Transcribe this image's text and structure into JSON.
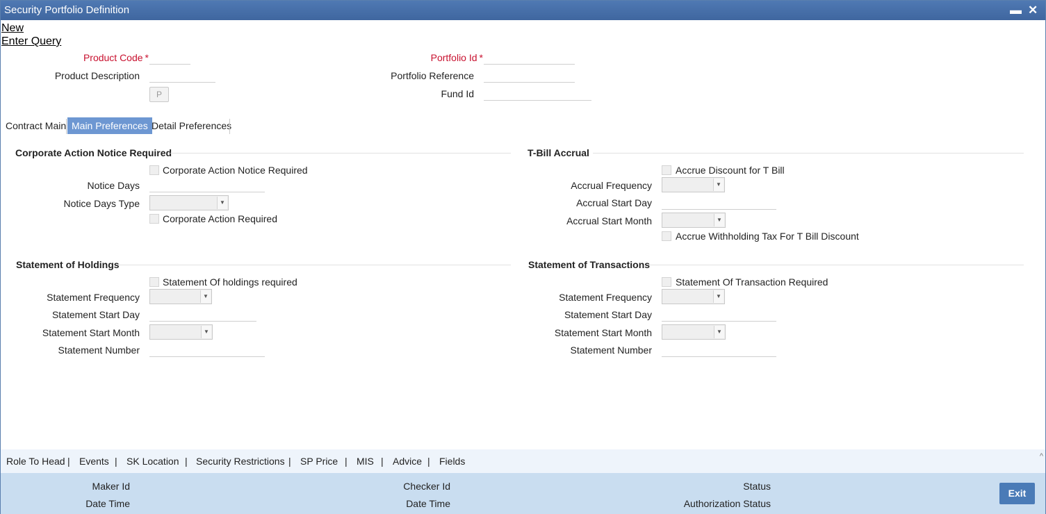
{
  "window": {
    "title": "Security Portfolio Definition",
    "minimize_icon": "minimize-icon",
    "close_icon": "close-icon",
    "minimize_glyph": "▬",
    "close_glyph": "✕"
  },
  "menu": {
    "new": "New",
    "enter_query": "Enter Query"
  },
  "header": {
    "product_code": "Product Code",
    "product_description": "Product Description",
    "p_button": "P",
    "portfolio_id": "Portfolio Id",
    "portfolio_reference": "Portfolio Reference",
    "fund_id": "Fund Id",
    "required_mark": "*"
  },
  "tabs": {
    "contract_main": "Contract Main",
    "main_preferences": "Main Preferences",
    "detail_preferences": "Detail Preferences",
    "active": "Main Preferences"
  },
  "corporate_action": {
    "title": "Corporate Action Notice Required",
    "notice_required": "Corporate Action Notice Required",
    "notice_days": "Notice Days",
    "notice_days_type": "Notice Days Type",
    "action_required": "Corporate Action Required"
  },
  "tbill": {
    "title": "T-Bill Accrual",
    "accrue_discount": "Accrue Discount for T Bill",
    "accrual_frequency": "Accrual Frequency",
    "accrual_start_day": "Accrual Start Day",
    "accrual_start_month": "Accrual Start Month",
    "accrue_withholding": "Accrue Withholding Tax For T Bill Discount"
  },
  "holdings": {
    "title": "Statement of Holdings",
    "required": "Statement Of holdings required",
    "frequency": "Statement Frequency",
    "start_day": "Statement Start Day",
    "start_month": "Statement Start Month",
    "number": "Statement Number"
  },
  "transactions": {
    "title": "Statement of Transactions",
    "required": "Statement Of Transaction Required",
    "frequency": "Statement Frequency",
    "start_day": "Statement Start Day",
    "start_month": "Statement Start Month",
    "number": "Statement Number"
  },
  "footer_nav": {
    "items": [
      "Role To Head",
      "Events",
      "SK Location",
      "Security Restrictions",
      "SP Price",
      "MIS",
      "Advice",
      "Fields"
    ],
    "separator": "|",
    "caret": "^"
  },
  "audit": {
    "maker_id": "Maker Id",
    "maker_date_time": "Date Time",
    "checker_id": "Checker Id",
    "checker_date_time": "Date Time",
    "status": "Status",
    "authorization_status": "Authorization Status",
    "exit": "Exit"
  },
  "colors": {
    "titlebar": "#4f79b3",
    "required": "#c8102e",
    "active_tab": "#6d97d2",
    "audit_bg": "#c9ddf0",
    "exit_button": "#4a7bb7"
  }
}
